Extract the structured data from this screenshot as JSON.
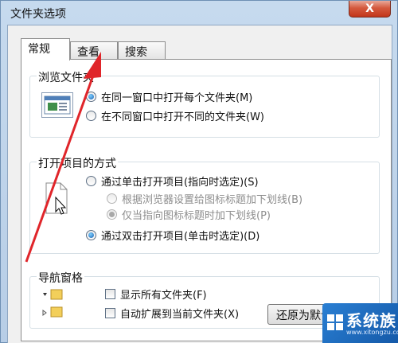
{
  "window": {
    "title": "文件夹选项",
    "close_label": "X"
  },
  "tabs": [
    {
      "label": "常规",
      "active": true
    },
    {
      "label": "查看",
      "active": false
    },
    {
      "label": "搜索",
      "active": false
    }
  ],
  "browse_folders": {
    "title": "浏览文件夹",
    "options": [
      {
        "label": "在同一窗口中打开每个文件夹(M)",
        "checked": true
      },
      {
        "label": "在不同窗口中打开不同的文件夹(W)",
        "checked": false
      }
    ]
  },
  "click_items": {
    "title": "打开项目的方式",
    "options": [
      {
        "label": "通过单击打开项目(指向时选定)(S)",
        "checked": false,
        "disabled": false
      },
      {
        "label": "根据浏览器设置给图标标题加下划线(B)",
        "checked": false,
        "disabled": true
      },
      {
        "label": "仅当指向图标标题时加下划线(P)",
        "checked": true,
        "disabled": true
      },
      {
        "label": "通过双击打开项目(单击时选定)(D)",
        "checked": true,
        "disabled": false
      }
    ]
  },
  "navigation_pane": {
    "title": "导航窗格",
    "options": [
      {
        "label": "显示所有文件夹(F)",
        "checked": false
      },
      {
        "label": "自动扩展到当前文件夹(X)",
        "checked": false
      }
    ]
  },
  "buttons": {
    "restore_defaults": "还原为默认值(R)"
  },
  "watermark": {
    "text": "系统族",
    "url": "www.xitongzu.com"
  },
  "colors": {
    "annotation_arrow": "#e0252a",
    "title_bar": "#c6daee",
    "close_button": "#c2351a"
  }
}
